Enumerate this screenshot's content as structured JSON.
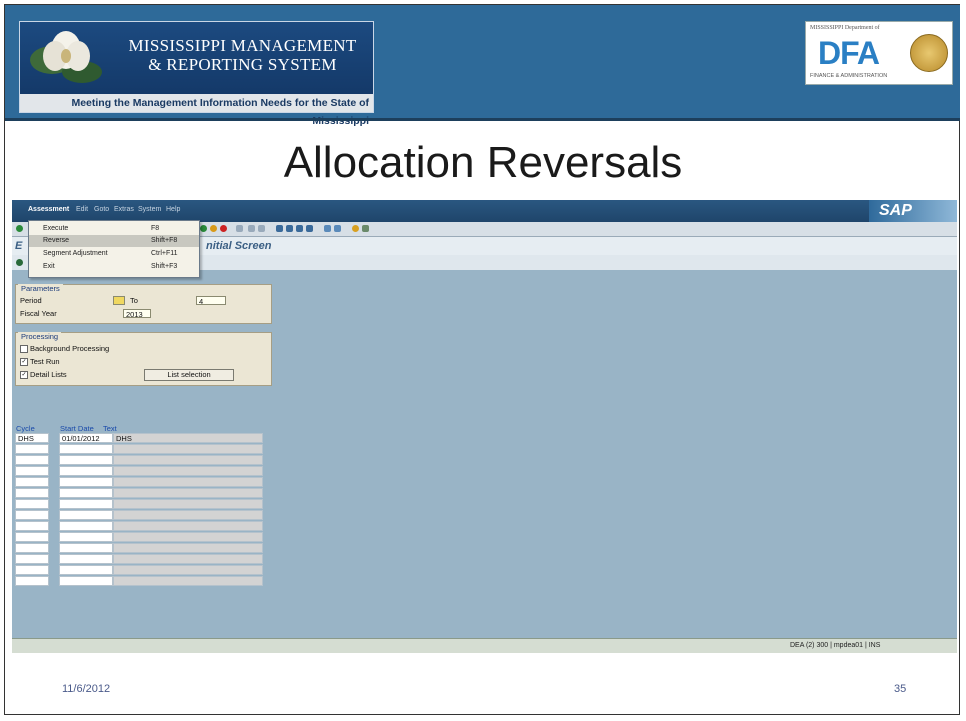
{
  "header": {
    "banner_title_line1": "MISSISSIPPI MANAGEMENT",
    "banner_title_line2": "& REPORTING SYSTEM",
    "banner_tagline": "Meeting the Management Information Needs for the State of Mississippi",
    "dfa_top_text": "MISSISSIPPI Department of",
    "dfa_letters": "DFA",
    "dfa_bottom_text": "FINANCE & ADMINISTRATION"
  },
  "slide": {
    "title": "Allocation Reversals",
    "date": "11/6/2012",
    "page_number": "35"
  },
  "sap": {
    "menu": [
      "Assessment",
      "Edit",
      "Goto",
      "Extras",
      "System",
      "Help"
    ],
    "logo": "SAP",
    "screen_title": "nitial Screen",
    "title_prefix": "E",
    "dropdown": [
      {
        "label": "Execute",
        "shortcut": "F8"
      },
      {
        "label": "Reverse",
        "shortcut": "Shift+F8"
      },
      {
        "label": "Segment Adjustment",
        "shortcut": "Ctrl+F11"
      },
      {
        "label": "Exit",
        "shortcut": "Shift+F3"
      }
    ],
    "parameters": {
      "group_label": "Parameters",
      "period_label": "Period",
      "period_to_label": "To",
      "period_to_value": "4",
      "fiscal_year_label": "Fiscal Year",
      "fiscal_year_value": "2013"
    },
    "processing": {
      "group_label": "Processing",
      "background_label": "Background Processing",
      "test_run_label": "Test Run",
      "detail_lists_label": "Detail Lists",
      "list_selection_button": "List selection",
      "background_checked": false,
      "test_run_checked": true,
      "detail_lists_checked": true
    },
    "grid": {
      "columns": [
        "Cycle",
        "Start Date",
        "Text"
      ],
      "rows": [
        [
          "DHS",
          "01/01/2012",
          "DHS"
        ],
        [
          "",
          "",
          ""
        ],
        [
          "",
          "",
          ""
        ],
        [
          "",
          "",
          ""
        ],
        [
          "",
          "",
          ""
        ],
        [
          "",
          "",
          ""
        ],
        [
          "",
          "",
          ""
        ],
        [
          "",
          "",
          ""
        ],
        [
          "",
          "",
          ""
        ],
        [
          "",
          "",
          ""
        ],
        [
          "",
          "",
          ""
        ],
        [
          "",
          "",
          ""
        ],
        [
          "",
          "",
          ""
        ],
        [
          "",
          "",
          ""
        ]
      ]
    },
    "status": "DEA (2) 300 | mpdea01 | INS"
  }
}
